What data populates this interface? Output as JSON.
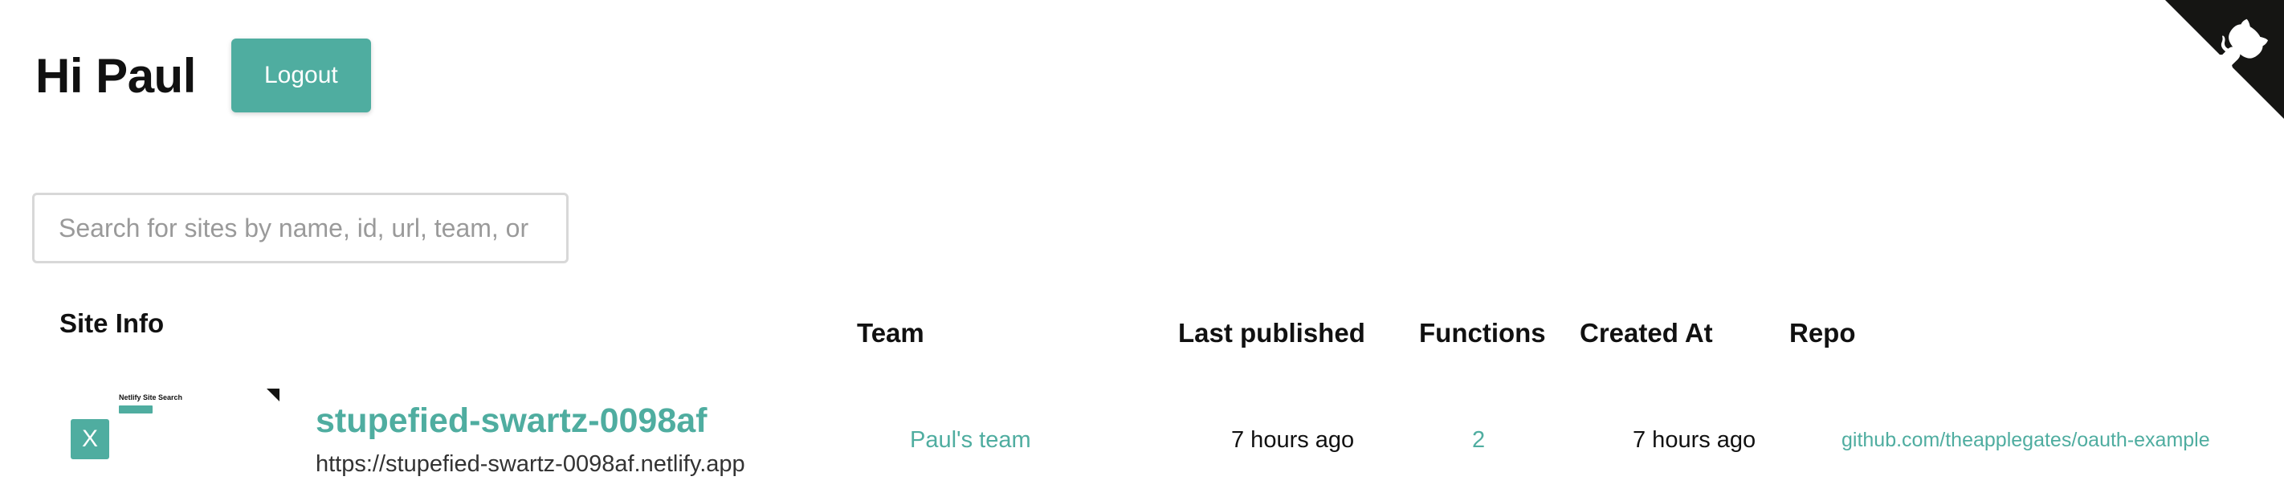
{
  "header": {
    "greeting": "Hi Paul",
    "logout_label": "Logout"
  },
  "search": {
    "placeholder": "Search for sites by name, id, url, team, or",
    "value": ""
  },
  "table": {
    "headers": {
      "site_info": "Site Info",
      "team": "Team",
      "last_published": "Last published",
      "functions": "Functions",
      "created_at": "Created At",
      "repo": "Repo"
    },
    "rows": [
      {
        "thumbnail_title": "Netlify Site Search",
        "badge": "X",
        "name": "stupefied-swartz-0098af",
        "url": "https://stupefied-swartz-0098af.netlify.app",
        "team": "Paul's team",
        "last_published": "7 hours ago",
        "functions": "2",
        "created_at": "7 hours ago",
        "repo": "github.com/theapplegates/oauth-example"
      }
    ]
  },
  "icons": {
    "github_corner": "github-octocat-icon",
    "thumbnail_corner": "github-corner-icon"
  },
  "colors": {
    "accent": "#4fada0",
    "corner": "#151513",
    "text": "#111111",
    "border": "#d8d8d8"
  }
}
